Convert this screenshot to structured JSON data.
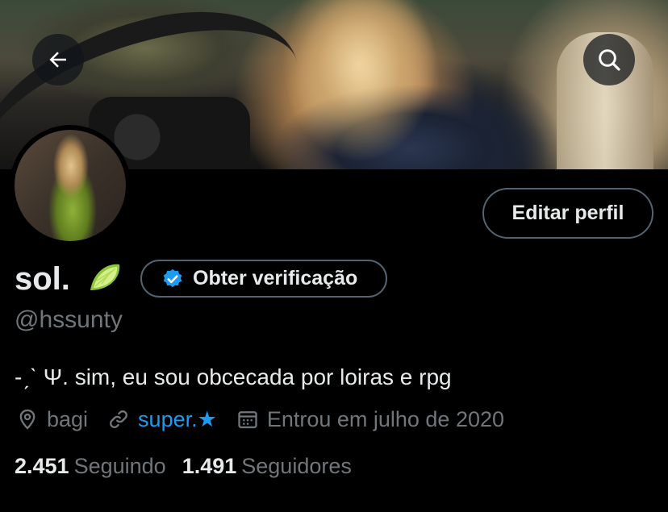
{
  "header": {
    "back_icon": "arrow-left-icon",
    "search_icon": "search-icon"
  },
  "profile": {
    "display_name": "sol.",
    "name_emoji": "lime-icon",
    "verify_button_label": "Obter verificação",
    "verify_icon": "verified-badge-icon",
    "edit_button_label": "Editar perfil",
    "handle": "@hssunty",
    "bio": "-ˏˋ Ψ. sim, eu sou obcecada por loiras e rpg",
    "location": "bagi",
    "location_icon": "location-pin-icon",
    "website": "super.★",
    "website_icon": "link-icon",
    "joined": "Entrou em julho de 2020",
    "joined_icon": "calendar-icon",
    "following_count": "2.451",
    "following_label": "Seguindo",
    "followers_count": "1.491",
    "followers_label": "Seguidores"
  },
  "colors": {
    "background": "#000000",
    "text_primary": "#e7e9ea",
    "text_secondary": "#71767b",
    "accent_link": "#1d9bf0",
    "border": "#536471"
  }
}
